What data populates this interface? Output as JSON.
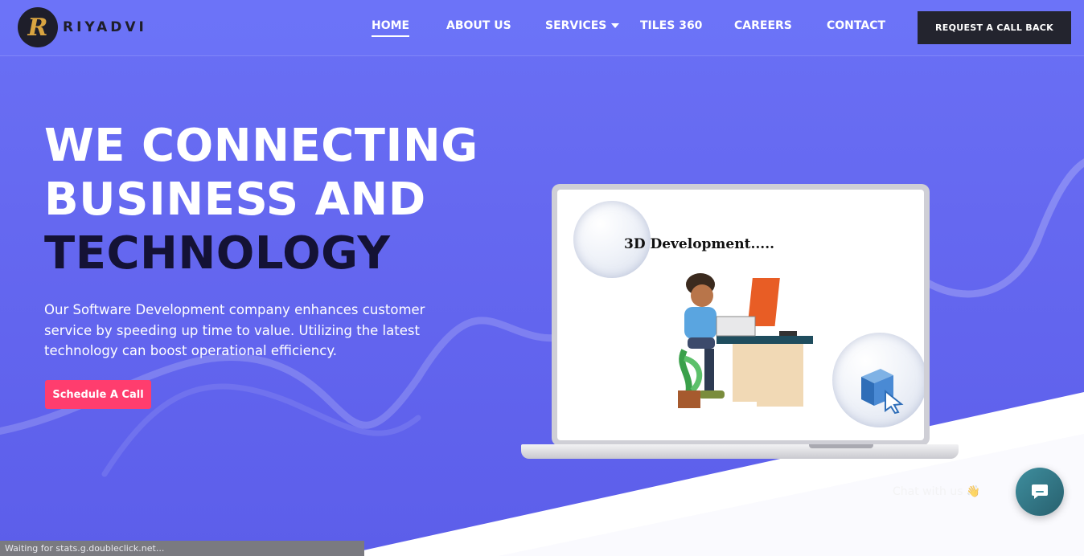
{
  "brand": {
    "logo_letter": "R",
    "name": "RIYADVI"
  },
  "nav": {
    "items": [
      {
        "label": "HOME",
        "active": true
      },
      {
        "label": "ABOUT US",
        "active": false
      },
      {
        "label": "SERVICES",
        "active": false,
        "dropdown": true
      },
      {
        "label": "TILES 360",
        "active": false
      },
      {
        "label": "CAREERS",
        "active": false
      },
      {
        "label": "CONTACT",
        "active": false
      }
    ],
    "cta_label": "REQUEST A CALL BACK"
  },
  "hero": {
    "headline_line1": "WE CONNECTING",
    "headline_line2": "BUSINESS AND",
    "headline_line3": "TECHNOLOGY",
    "subtitle": "Our Software Development company enhances customer service by speeding up time to value. Utilizing the latest technology can boost operational efficiency.",
    "cta_label": "Schedule A Call"
  },
  "laptop": {
    "screen_title": "3D Development....."
  },
  "chat": {
    "hint": "Chat with us 👋",
    "icon": "chat-bubble-icon"
  },
  "status_bar": {
    "text": "Waiting for stats.g.doubleclick.net..."
  },
  "colors": {
    "hero_bg": "#6366f1",
    "cta_dark": "#23242e",
    "accent_pink": "#ff3d6e",
    "headline_dark": "#141235",
    "chat_teal": "#3e8e9e"
  }
}
